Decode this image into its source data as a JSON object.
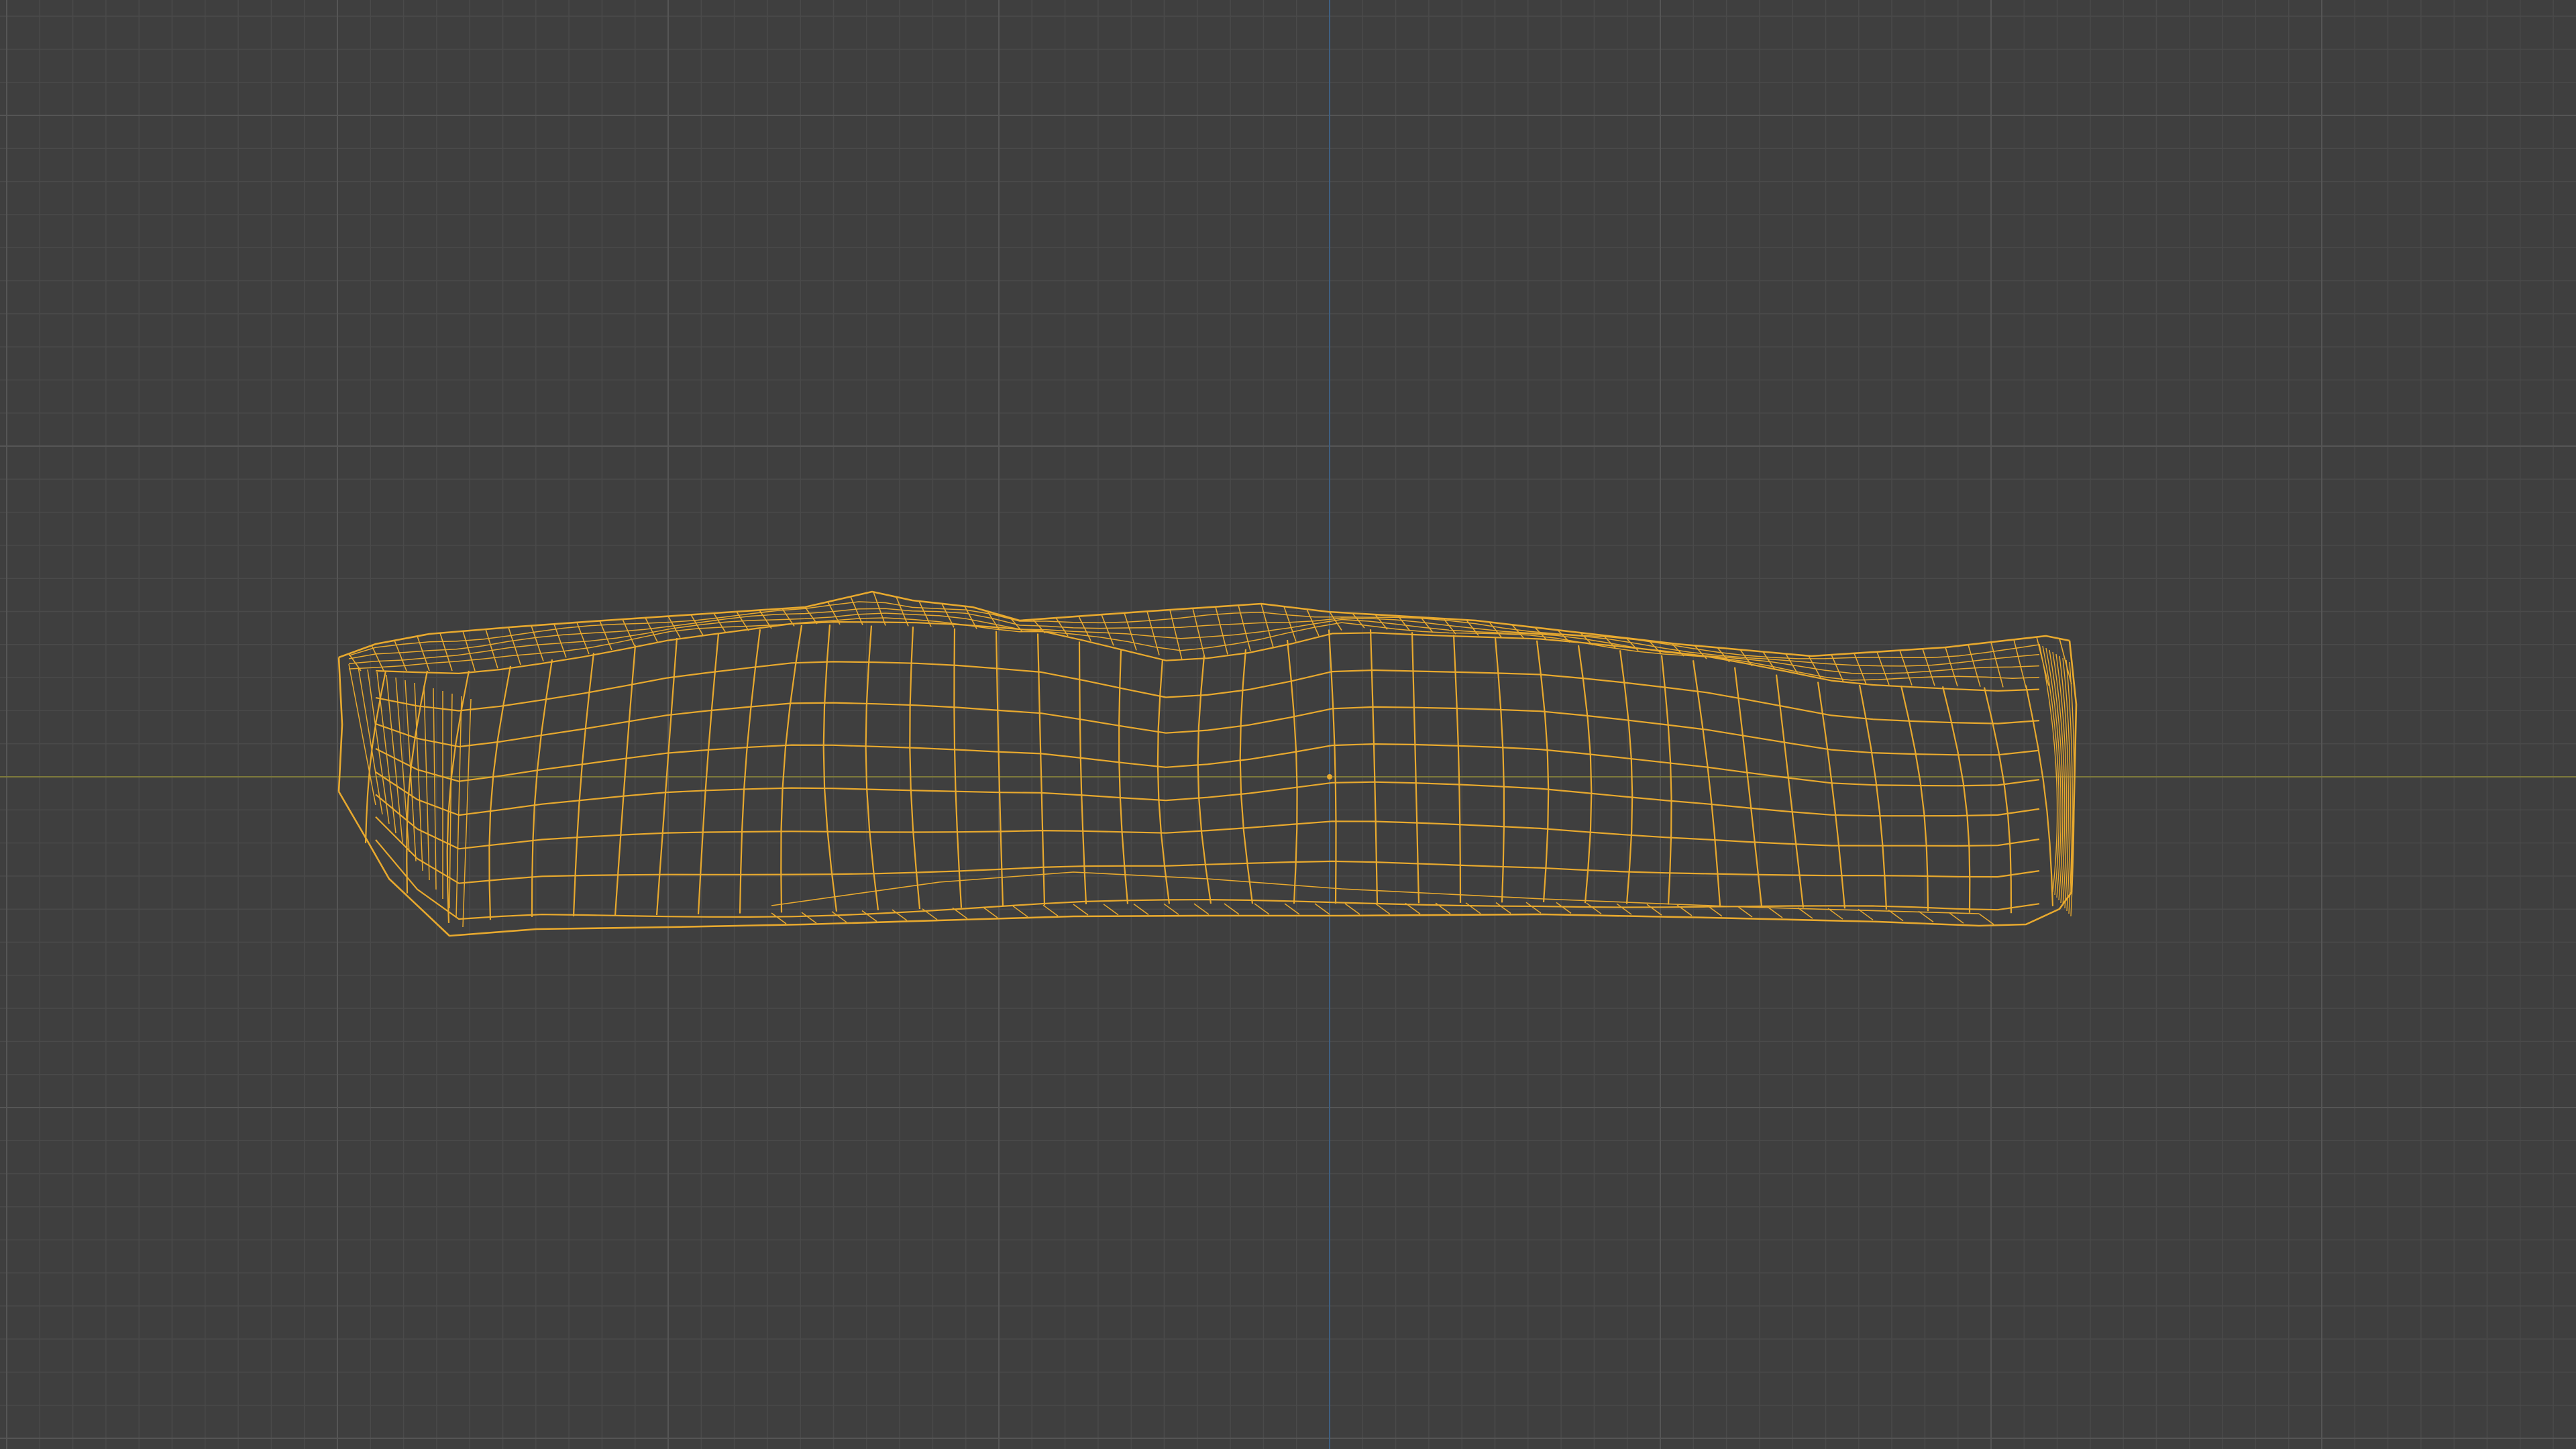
{
  "viewport": {
    "view": "front-orthographic",
    "display_mode": "wireframe",
    "background_color": "#3f3f3f",
    "grid": {
      "visible": true,
      "minor_line_color": "#4a4a4a",
      "major_line_color": "#555555"
    },
    "axes": {
      "x_axis_color": "#7d7a3c",
      "z_axis_color": "#3f5f80"
    }
  },
  "scene": {
    "object": {
      "type": "mesh",
      "selected": true,
      "wire_color": "#e8a92e",
      "origin_color": "#e8a92e"
    }
  }
}
